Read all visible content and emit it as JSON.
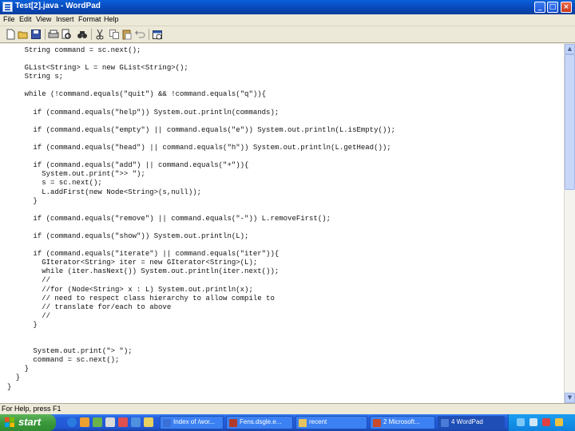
{
  "window": {
    "title": "Test[2].java - WordPad",
    "buttons": {
      "minimize": "_",
      "maximize": "□",
      "close": "×"
    }
  },
  "menu": [
    "File",
    "Edit",
    "View",
    "Insert",
    "Format",
    "Help"
  ],
  "toolbar": {
    "icons": [
      "new-icon",
      "open-icon",
      "save-icon",
      "print-icon",
      "print-preview-icon",
      "find-icon",
      "cut-icon",
      "copy-icon",
      "paste-icon",
      "undo-icon",
      "date-time-icon"
    ]
  },
  "editor": {
    "lines": [
      "    String command = sc.next();",
      "",
      "    GList<String> L = new GList<String>();",
      "    String s;",
      "",
      "    while (!command.equals(\"quit\") && !command.equals(\"q\")){",
      "",
      "      if (command.equals(\"help\")) System.out.println(commands);",
      "",
      "      if (command.equals(\"empty\") || command.equals(\"e\")) System.out.println(L.isEmpty());",
      "",
      "      if (command.equals(\"head\") || command.equals(\"h\")) System.out.println(L.getHead());",
      "",
      "      if (command.equals(\"add\") || command.equals(\"+\")){",
      "        System.out.print(\">> \");",
      "        s = sc.next();",
      "        L.addFirst(new Node<String>(s,null));",
      "      }",
      "",
      "      if (command.equals(\"remove\") || command.equals(\"-\")) L.removeFirst();",
      "",
      "      if (command.equals(\"show\")) System.out.println(L);",
      "",
      "      if (command.equals(\"iterate\") || command.equals(\"iter\")){",
      "        GIterator<String> iter = new GIterator<String>(L);",
      "        while (iter.hasNext()) System.out.println(iter.next());",
      "        //",
      "        //for (Node<String> x : L) System.out.println(x);",
      "        // need to respect class hierarchy to allow compile to",
      "        // translate for/each to above",
      "        //",
      "      }",
      "",
      "",
      "      System.out.print(\"> \");",
      "      command = sc.next();",
      "    }",
      "  }",
      "}"
    ]
  },
  "status": {
    "text": "For Help, press F1"
  },
  "taskbar": {
    "start_label": "start",
    "tasks": [
      {
        "label": "Index of /wor...",
        "icon_color": "#3a6fd6"
      },
      {
        "label": "Fens.dsgle.e...",
        "icon_color": "#b03a2e"
      },
      {
        "label": "recent",
        "icon_color": "#e6c35c"
      },
      {
        "label": "2 Microsoft...",
        "icon_color": "#c84a2a"
      },
      {
        "label": "4 WordPad",
        "icon_color": "#4b7bd8",
        "active": true
      }
    ],
    "tray_icons": [
      "network-icon",
      "volume-icon",
      "security-icon",
      "antivirus-icon"
    ]
  },
  "colors": {
    "titlebar": "#0846b8",
    "taskbar": "#245edc",
    "start": "#3c9a3c"
  }
}
